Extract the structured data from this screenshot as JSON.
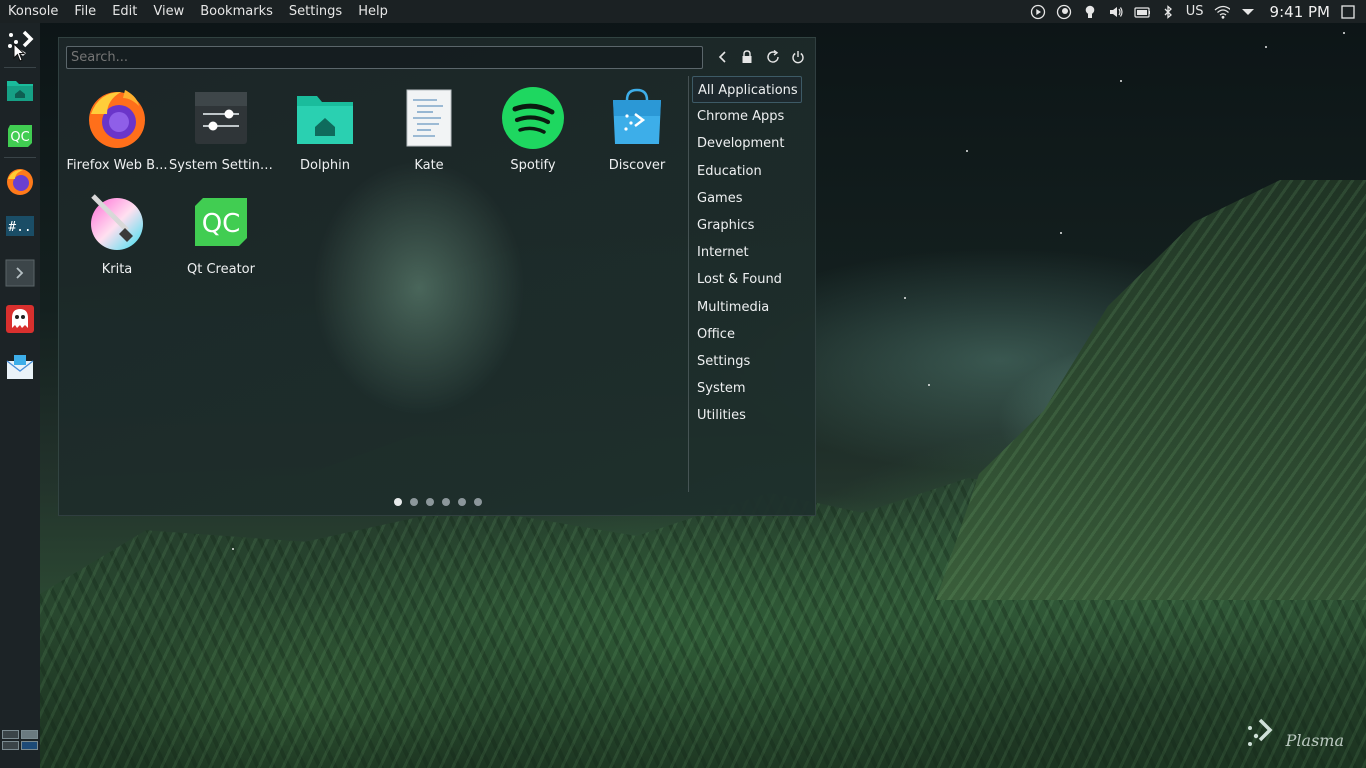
{
  "menubar": {
    "app_name": "Konsole",
    "items": [
      "File",
      "Edit",
      "View",
      "Bookmarks",
      "Settings",
      "Help"
    ]
  },
  "tray": {
    "keyboard_layout": "US",
    "time": "9:41 PM"
  },
  "dock": {
    "items": [
      {
        "name": "plasma-launcher-icon"
      },
      {
        "name": "dolphin-icon"
      },
      {
        "name": "qt-creator-icon"
      },
      {
        "name": "firefox-icon"
      },
      {
        "name": "chat-icon",
        "text": "#.."
      },
      {
        "name": "terminal-icon"
      },
      {
        "name": "ghost-app-icon"
      },
      {
        "name": "mail-icon"
      }
    ]
  },
  "launcher": {
    "search_placeholder": "Search...",
    "apps": [
      {
        "label": "Firefox Web B...",
        "icon": "firefox-icon"
      },
      {
        "label": "System Settings",
        "icon": "system-settings-icon"
      },
      {
        "label": "Dolphin",
        "icon": "dolphin-icon"
      },
      {
        "label": "Kate",
        "icon": "kate-icon"
      },
      {
        "label": "Spotify",
        "icon": "spotify-icon"
      },
      {
        "label": "Discover",
        "icon": "discover-icon"
      },
      {
        "label": "Krita",
        "icon": "krita-icon"
      },
      {
        "label": "Qt Creator",
        "icon": "qt-creator-icon"
      }
    ],
    "categories": [
      "All Applications",
      "Chrome Apps",
      "Development",
      "Education",
      "Games",
      "Graphics",
      "Internet",
      "Lost & Found",
      "Multimedia",
      "Office",
      "Settings",
      "System",
      "Utilities"
    ],
    "active_category": "All Applications",
    "pages": 6,
    "active_page": 1
  },
  "wallpaper": {
    "brand_text": "Plasma"
  },
  "colors": {
    "accent_teal": "#1abc9c",
    "spotify_green": "#1db954",
    "panel_bg": "#1c2326"
  }
}
